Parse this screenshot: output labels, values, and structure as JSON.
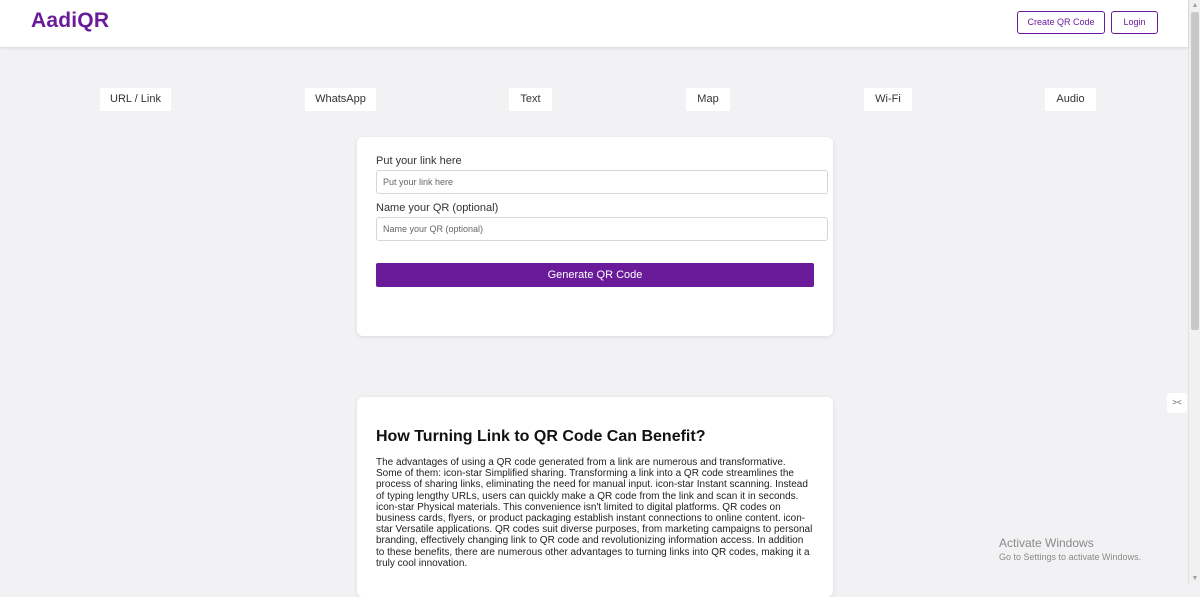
{
  "header": {
    "logo": "AadiQR",
    "create_qr_label": "Create QR Code",
    "login_label": "Login"
  },
  "tabs": [
    {
      "label": "URL / Link"
    },
    {
      "label": "WhatsApp"
    },
    {
      "label": "Text"
    },
    {
      "label": "Map"
    },
    {
      "label": "Wi-Fi"
    },
    {
      "label": "Audio"
    }
  ],
  "form": {
    "link_label": "Put your link here",
    "link_placeholder": "Put your link here",
    "link_value": "",
    "name_label": "Name your QR (optional)",
    "name_placeholder": "Name your QR (optional)",
    "name_value": "",
    "generate_label": "Generate QR Code"
  },
  "info": {
    "title": "How Turning Link to QR Code Can Benefit?",
    "body": "The advantages of using a QR code generated from a link are numerous and transformative. Some of them: icon-star Simplified sharing. Transforming a link into a QR code streamlines the process of sharing links, eliminating the need for manual input. icon-star Instant scanning. Instead of typing lengthy URLs, users can quickly make a QR code from the link and scan it in seconds. icon-star Physical materials. This convenience isn't limited to digital platforms. QR codes on business cards, flyers, or product packaging establish instant connections to online content. icon-star Versatile applications. QR codes suit diverse purposes, from marketing campaigns to personal branding, effectively changing link to QR code and revolutionizing information access. In addition to these benefits, there are numerous other advantages to turning links into QR codes, making it a truly cool innovation."
  },
  "side_widget": {
    "icon": "collapse-arrows-icon",
    "glyph": "><"
  },
  "watermark": {
    "title": "Activate Windows",
    "subtitle": "Go to Settings to activate Windows."
  },
  "colors": {
    "brand": "#6a1b9a",
    "background": "#f2f2f4",
    "card": "#ffffff"
  }
}
